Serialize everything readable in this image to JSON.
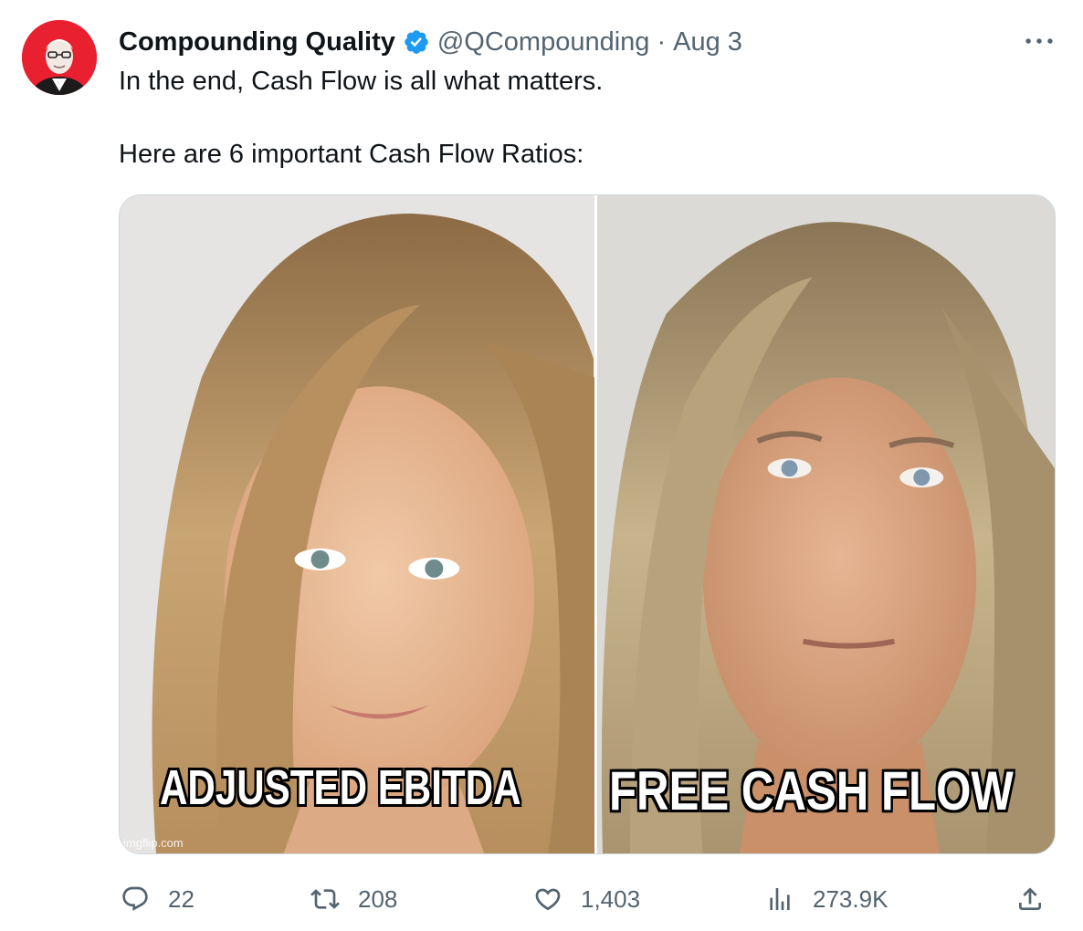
{
  "author": {
    "display_name": "Compounding Quality",
    "handle": "@QCompounding",
    "separator": "·",
    "date": "Aug 3",
    "avatar_icon": "portrait-avatar",
    "avatar_bg": "#e8202f",
    "verified_color": "#1d9bf0"
  },
  "tweet": {
    "line1": "In the end, Cash Flow is all what matters.",
    "line2": "Here are 6 important Cash Flow Ratios:"
  },
  "media": {
    "caption_left": "ADJUSTED EBITDA",
    "caption_right": "FREE CASH FLOW",
    "watermark": "imgflip.com"
  },
  "actions": {
    "reply_count": "22",
    "retweet_count": "208",
    "like_count": "1,403",
    "views_count": "273.9K"
  },
  "colors": {
    "text_primary": "#0f1419",
    "text_secondary": "#536471",
    "border": "#cfd9de"
  }
}
